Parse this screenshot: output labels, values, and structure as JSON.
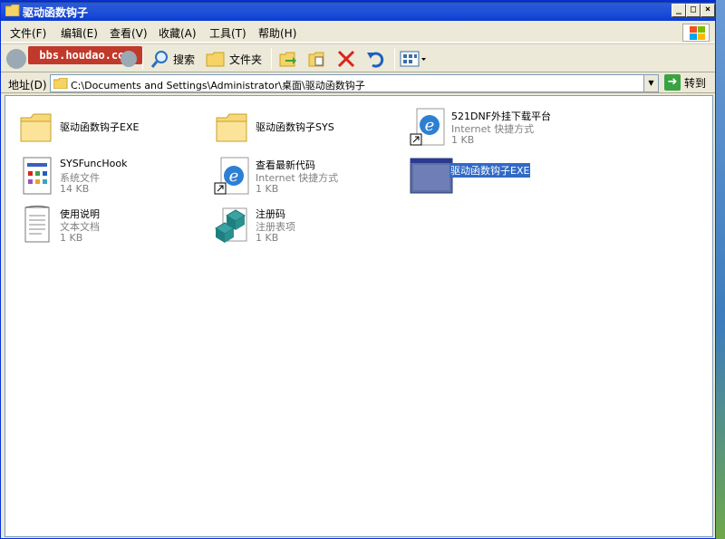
{
  "window": {
    "title": "驱动函数钩子",
    "buttons": {
      "minimize": "_",
      "maximize": "□",
      "close": "×"
    }
  },
  "menu": [
    {
      "label": "文件(F)"
    },
    {
      "label": "编辑(E)"
    },
    {
      "label": "查看(V)"
    },
    {
      "label": "收藏(A)"
    },
    {
      "label": "工具(T)"
    },
    {
      "label": "帮助(H)"
    }
  ],
  "watermark": "bbs.houdao.com",
  "toolbar": {
    "search_label": "搜索",
    "folders_label": "文件夹"
  },
  "address": {
    "label": "地址(D)",
    "value": "C:\\Documents and Settings\\Administrator\\桌面\\驱动函数钩子",
    "go_label": "转到"
  },
  "items": [
    {
      "name": "驱动函数钩子EXE",
      "type": "",
      "size": ""
    },
    {
      "name": "驱动函数钩子SYS",
      "type": "",
      "size": ""
    },
    {
      "name": "521DNF外挂下载平台",
      "type": "Internet 快捷方式",
      "size": "1 KB"
    },
    {
      "name": "SYSFuncHook",
      "type": "系统文件",
      "size": "14 KB"
    },
    {
      "name": "查看最新代码",
      "type": "Internet 快捷方式",
      "size": "1 KB"
    },
    {
      "name": "驱动函数钩子EXE",
      "type": "",
      "size": ""
    },
    {
      "name": "使用说明",
      "type": "文本文档",
      "size": "1 KB"
    },
    {
      "name": "注册码",
      "type": "注册表项",
      "size": "1 KB"
    }
  ],
  "colors": {
    "titlebar": "#0b3bd1",
    "selection": "#316ac5",
    "chrome": "#ece9d8"
  }
}
